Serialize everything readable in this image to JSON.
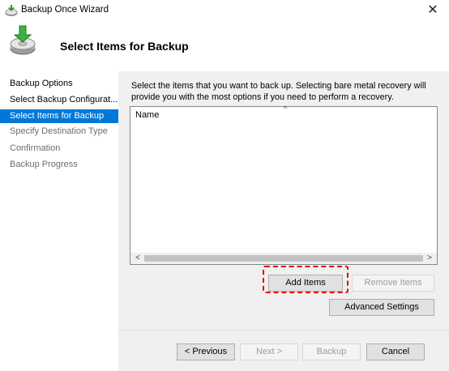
{
  "window": {
    "title": "Backup Once Wizard",
    "close_glyph": "✕"
  },
  "header": {
    "title": "Select Items for Backup"
  },
  "sidebar": {
    "items": [
      {
        "label": "Backup Options",
        "state": "done"
      },
      {
        "label": "Select Backup Configurat...",
        "state": "done"
      },
      {
        "label": "Select Items for Backup",
        "state": "active"
      },
      {
        "label": "Specify Destination Type",
        "state": "pending"
      },
      {
        "label": "Confirmation",
        "state": "pending"
      },
      {
        "label": "Backup Progress",
        "state": "pending"
      }
    ]
  },
  "main": {
    "instructions": "Select the items that you want to back up. Selecting bare metal recovery will provide you with the most options if you need to perform a recovery.",
    "list": {
      "column_header": "Name",
      "sort_glyph": "^",
      "scroll_left_glyph": "<",
      "scroll_right_glyph": ">"
    },
    "buttons": {
      "add_items": "Add Items",
      "remove_items": "Remove Items",
      "advanced_settings": "Advanced Settings"
    }
  },
  "footer": {
    "previous": "< Previous",
    "next": "Next >",
    "backup": "Backup",
    "cancel": "Cancel"
  },
  "colors": {
    "selection": "#0078d7",
    "highlight": "#e00000",
    "panel": "#f0f0f0"
  },
  "icons": {
    "title": "backup-disk-icon",
    "header": "backup-drive-arrow-icon"
  }
}
